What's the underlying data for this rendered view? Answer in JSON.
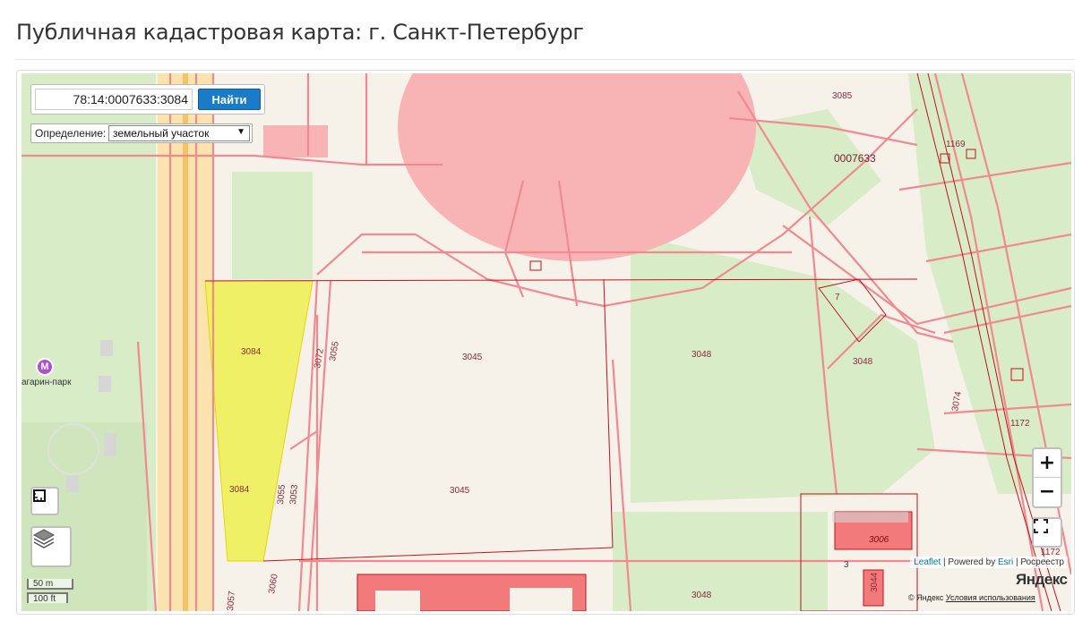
{
  "page": {
    "title": "Публичная кадастровая карта: г. Санкт-Петербург"
  },
  "search": {
    "value": "78:14:0007633:3084",
    "button_label": "Найти"
  },
  "definition": {
    "label": "Определение:",
    "selected": "земельный участок",
    "arrow": "▼"
  },
  "controls": {
    "zoom_in": "+",
    "zoom_out": "−",
    "fullscreen_icon": "fullscreen-icon",
    "layers_icon": "layers-icon",
    "ruler_icon": "ruler-icon"
  },
  "scale": {
    "metric": "50 m",
    "imperial": "100 ft"
  },
  "attribution": {
    "leaflet": "Leaflet",
    "sep1": " | Powered by ",
    "esri": "Esri",
    "sep2": " | Росреестр"
  },
  "yandex": {
    "logo": "Яндекс",
    "terms_prefix": "© Яндекс ",
    "terms_link": "Условия использования"
  },
  "poi": {
    "metro": "агарин-парк",
    "metro_icon": "M"
  },
  "parcels": {
    "highlighted_color": "#f0f060",
    "labels": [
      {
        "id": "p3084a",
        "text": "3084"
      },
      {
        "id": "p3084b",
        "text": "3084"
      },
      {
        "id": "p3045a",
        "text": "3045"
      },
      {
        "id": "p3045b",
        "text": "3045"
      },
      {
        "id": "p3048a",
        "text": "3048"
      },
      {
        "id": "p3048b",
        "text": "3048"
      },
      {
        "id": "p3048c",
        "text": "3048"
      },
      {
        "id": "p3085",
        "text": "3085"
      },
      {
        "id": "p1169",
        "text": "1169"
      },
      {
        "id": "quarter",
        "text": "0007633"
      },
      {
        "id": "p7",
        "text": "7"
      },
      {
        "id": "p3072",
        "text": "3072"
      },
      {
        "id": "p3055a",
        "text": "3055"
      },
      {
        "id": "p3055b",
        "text": "3055"
      },
      {
        "id": "p3053",
        "text": "3053"
      },
      {
        "id": "p3074",
        "text": "3074"
      },
      {
        "id": "p1172a",
        "text": "1172"
      },
      {
        "id": "p1172b",
        "text": "1172"
      },
      {
        "id": "p3006",
        "text": "3006"
      },
      {
        "id": "p3",
        "text": "3"
      },
      {
        "id": "p3044",
        "text": "3044"
      },
      {
        "id": "p3060",
        "text": "3060"
      },
      {
        "id": "p3057",
        "text": "3057"
      }
    ]
  },
  "colors": {
    "map_bg": "#f6f2e9",
    "green": "#d8ecc8",
    "parcel_line": "#f08a90",
    "boundary": "#c0141c",
    "building": "#f8b4b4",
    "button": "#1a7bc9"
  }
}
